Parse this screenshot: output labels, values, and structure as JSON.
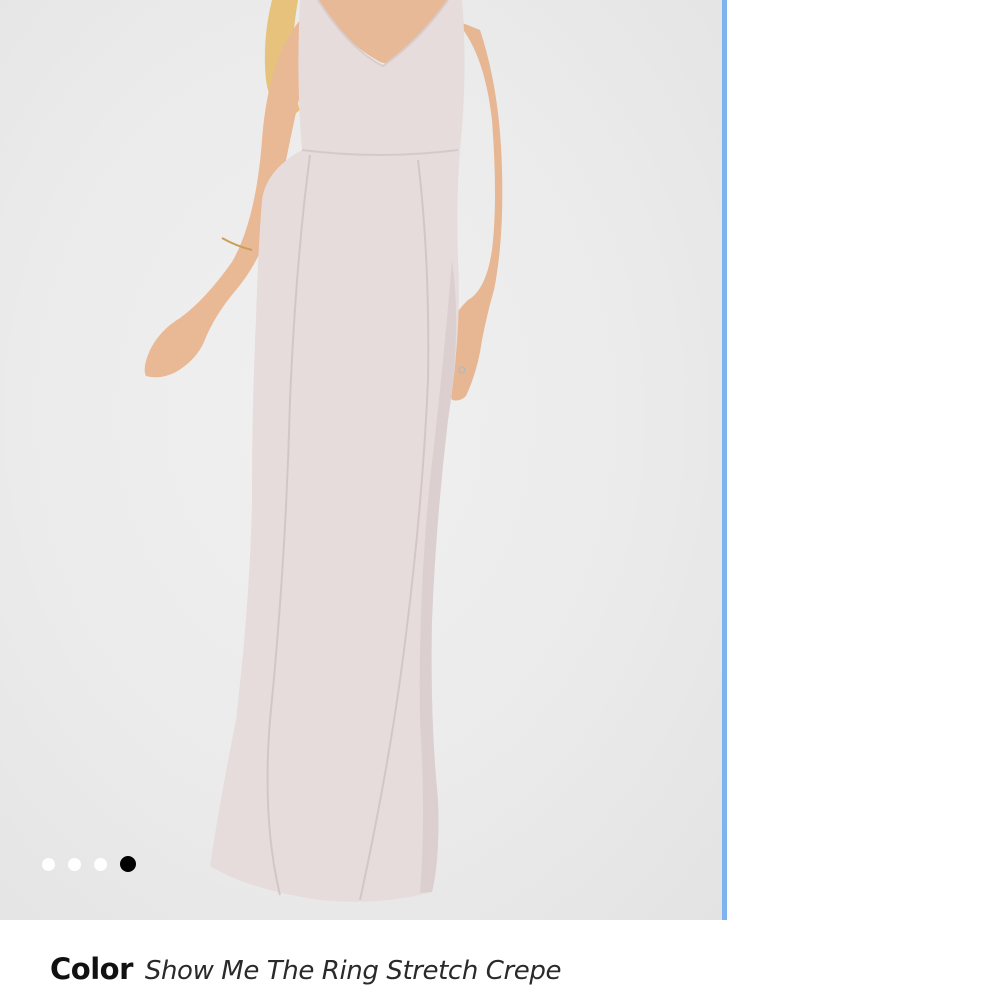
{
  "product": {
    "image": {
      "subject": "model-wearing-gown",
      "dress_color": "#e6dcdc",
      "background_color": "#ececec"
    },
    "carousel": {
      "total": 4,
      "active_index": 3
    },
    "color": {
      "label": "Color",
      "value": "Show Me The Ring Stretch Crepe"
    }
  },
  "theme": {
    "scroll_edge_color": "#7fb3ee",
    "active_dot_color": "#000000",
    "inactive_dot_color": "#ffffff"
  }
}
